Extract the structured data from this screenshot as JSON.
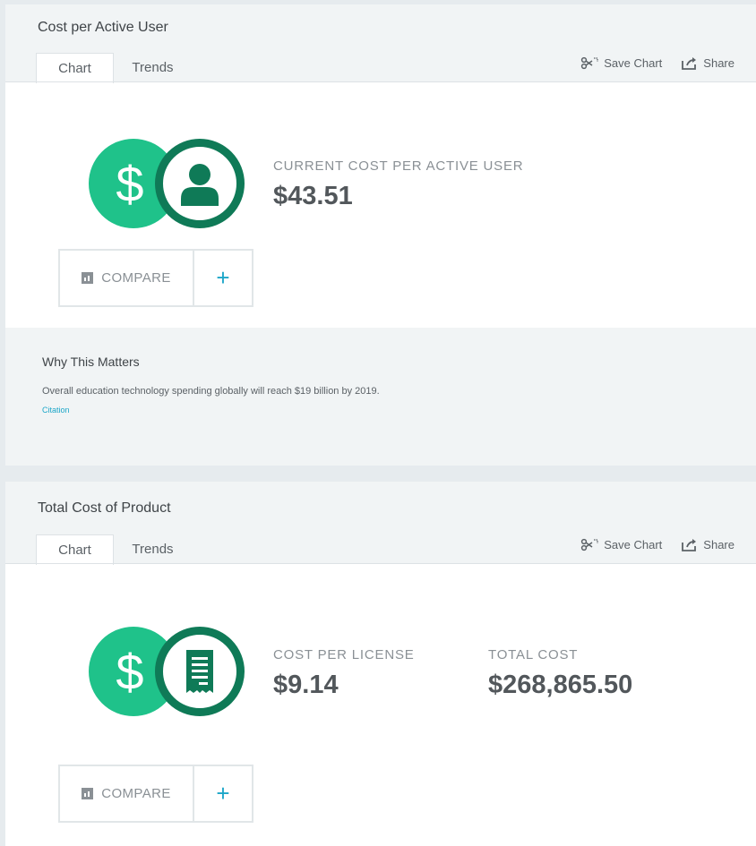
{
  "panels": [
    {
      "title": "Cost per Active User",
      "tabs": [
        {
          "label": "Chart"
        },
        {
          "label": "Trends"
        }
      ],
      "actions": {
        "save_chart": "Save Chart",
        "share": "Share"
      },
      "stats": [
        {
          "label": "CURRENT COST PER ACTIVE USER",
          "value": "$43.51"
        }
      ],
      "icon": {
        "left": "dollar-icon",
        "right": "user-icon",
        "dollar_glyph": "$"
      },
      "compare": {
        "label": "COMPARE",
        "plus": "+"
      },
      "why": {
        "title": "Why This Matters",
        "text": "Overall education technology spending globally will reach $19 billion by 2019.",
        "link": "Citation"
      }
    },
    {
      "title": "Total Cost of Product",
      "tabs": [
        {
          "label": "Chart"
        },
        {
          "label": "Trends"
        }
      ],
      "actions": {
        "save_chart": "Save Chart",
        "share": "Share"
      },
      "stats": [
        {
          "label": "COST PER LICENSE",
          "value": "$9.14"
        },
        {
          "label": "TOTAL COST",
          "value": "$268,865.50"
        }
      ],
      "icon": {
        "left": "dollar-icon",
        "right": "receipt-icon",
        "dollar_glyph": "$"
      },
      "compare": {
        "label": "COMPARE",
        "plus": "+"
      }
    }
  ],
  "colors": {
    "accent_green": "#1fc28a",
    "dark_green": "#0f7a57",
    "link_blue": "#1ca6c8",
    "panel_header": "#f1f4f5"
  }
}
